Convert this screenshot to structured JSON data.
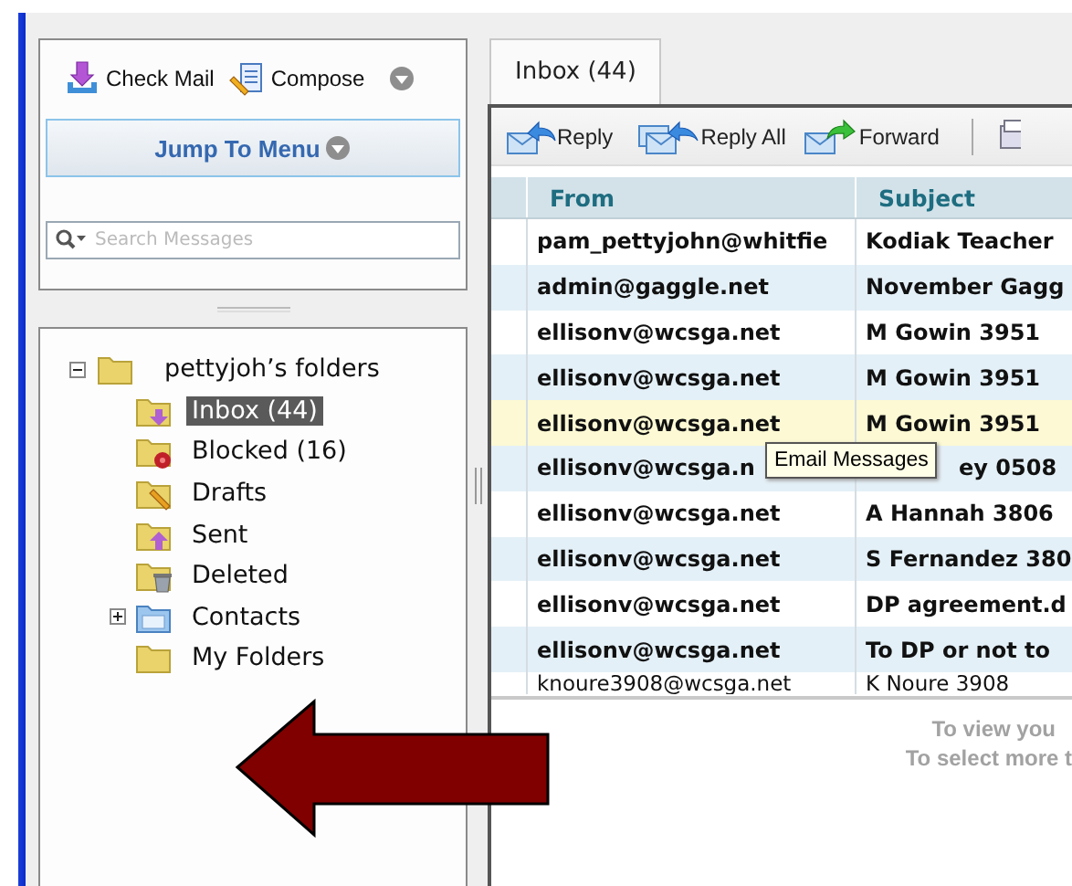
{
  "sidebar": {
    "actions": [
      {
        "label": "Check Mail",
        "kind": "check",
        "menu": false
      },
      {
        "label": "Compose",
        "kind": "compose",
        "menu": true
      }
    ],
    "jump_menu": {
      "label": "Jump To Menu"
    },
    "search": {
      "placeholder": "Search Messages"
    }
  },
  "folders": {
    "label": "pettyjoh’s folders",
    "expanded": true,
    "children": [
      {
        "label": "Inbox (44)",
        "kind": "inbox",
        "selected": true
      },
      {
        "label": "Blocked (16)",
        "kind": "blocked",
        "selected": false
      },
      {
        "label": "Drafts",
        "kind": "drafts",
        "selected": false
      },
      {
        "label": "Sent",
        "kind": "sent",
        "selected": false
      },
      {
        "label": "Deleted",
        "kind": "deleted",
        "selected": false
      },
      {
        "label": "Contacts",
        "kind": "contacts",
        "selected": false,
        "expanded": false
      },
      {
        "label": "My Folders",
        "kind": "folder",
        "selected": false
      }
    ]
  },
  "tabs": [
    {
      "label": "Inbox (44)",
      "selected": true
    }
  ],
  "toolbar": [
    {
      "label": "Reply",
      "kind": "reply"
    },
    {
      "label": "Reply All",
      "kind": "reply_all"
    },
    {
      "label": "Forward",
      "kind": "forward"
    },
    {
      "kind": "print"
    }
  ],
  "table": {
    "columns": [
      "From",
      "Subject"
    ],
    "rows": [
      {
        "from": "pam_pettyjohn@whitfie",
        "subject": "Kodiak Teacher",
        "unread": true,
        "selected": false
      },
      {
        "from": "admin@gaggle.net",
        "subject": "November Gagg",
        "unread": true,
        "selected": false
      },
      {
        "from": "ellisonv@wcsga.net",
        "subject": "M Gowin 3951",
        "unread": true,
        "selected": false
      },
      {
        "from": "ellisonv@wcsga.net",
        "subject": "M Gowin 3951",
        "unread": true,
        "selected": false
      },
      {
        "from": "ellisonv@wcsga.net",
        "subject": "M Gowin 3951",
        "unread": true,
        "selected": true
      },
      {
        "from": "ellisonv@wcsga.n",
        "subject": "ey 0508",
        "unread": true,
        "selected": false,
        "tooltip": "Email Messages"
      },
      {
        "from": "ellisonv@wcsga.net",
        "subject": "A Hannah 3806",
        "unread": true,
        "selected": false
      },
      {
        "from": "ellisonv@wcsga.net",
        "subject": "S Fernandez 380",
        "unread": true,
        "selected": false
      },
      {
        "from": "ellisonv@wcsga.net",
        "subject": "DP agreement.d",
        "unread": true,
        "selected": false
      },
      {
        "from": "ellisonv@wcsga.net",
        "subject": "To DP or not to",
        "unread": true,
        "selected": false
      },
      {
        "from": "knoure3908@wcsga.net",
        "subject": "K Noure 3908",
        "unread": false,
        "selected": false
      }
    ]
  },
  "preview": {
    "lines": [
      "To view you",
      "To select more t"
    ]
  }
}
